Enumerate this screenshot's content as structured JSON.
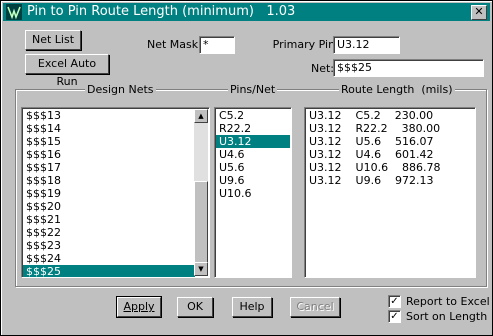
{
  "window": {
    "title": "Pin to Pin Route Length (minimum)   1.03",
    "close_glyph": "✕",
    "icon": "router-app-icon"
  },
  "buttons": {
    "net_list": "Net List",
    "excel_auto_run": "Excel Auto Run",
    "apply": "Apply",
    "ok": "OK",
    "help": "Help",
    "cancel": "Cancel"
  },
  "fields": {
    "net_mask_label": "Net Mask",
    "net_mask_value": "*",
    "primary_pin_label": "Primary Pin",
    "primary_pin_value": "U3.12",
    "net_label": "Net:",
    "net_value": "$$$25"
  },
  "groups": {
    "design_nets": "Design Nets",
    "pins_net": "Pins/Net",
    "route_length": "Route Length  (mils)"
  },
  "design_nets": [
    "$$$13",
    "$$$14",
    "$$$15",
    "$$$16",
    "$$$17",
    "$$$18",
    "$$$19",
    "$$$20",
    "$$$21",
    "$$$22",
    "$$$23",
    "$$$24",
    "$$$25"
  ],
  "design_nets_selected": "$$$25",
  "pins_net": [
    "C5.2",
    "R22.2",
    "U3.12",
    "U4.6",
    "U5.6",
    "U9.6",
    "U10.6"
  ],
  "pins_net_selected": "U3.12",
  "route_lengths": [
    "U3.12    C5.2    230.00",
    "U3.12    R22.2    380.00",
    "U3.12    U5.6    516.07",
    "U3.12    U4.6    601.42",
    "U3.12    U10.6    886.78",
    "U3.12    U9.6    972.13"
  ],
  "checkboxes": {
    "report_to_excel": {
      "label": "Report to Excel",
      "checked": true
    },
    "sort_on_length": {
      "label": "Sort on Length",
      "checked": true
    }
  },
  "colors": {
    "titlebar": "#008080",
    "selection": "#008080",
    "face": "#c0c0c0"
  }
}
